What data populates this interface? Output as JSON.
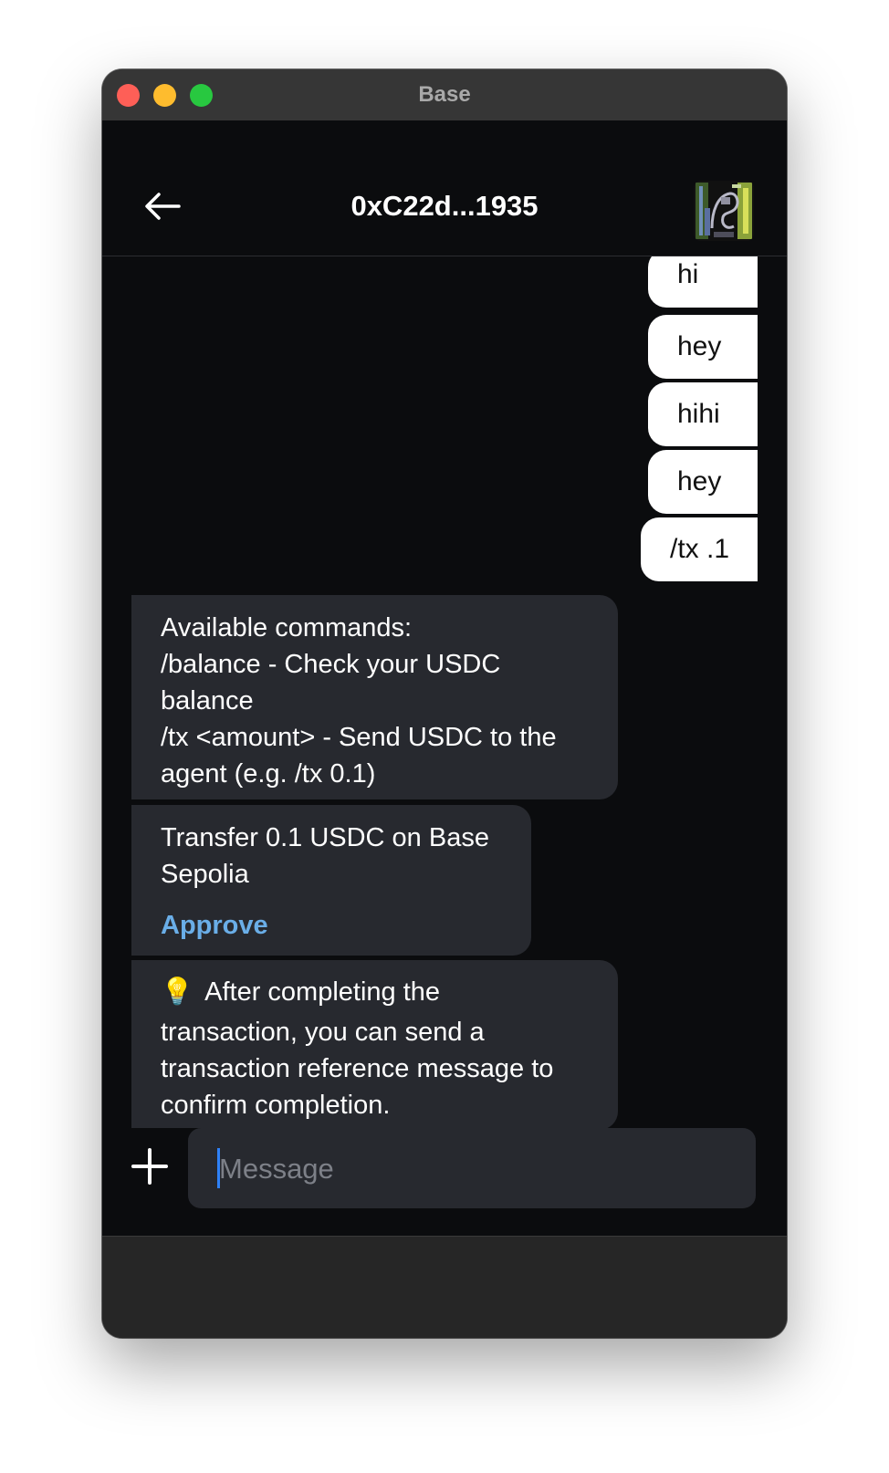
{
  "window": {
    "title": "Base"
  },
  "header": {
    "title": "0xC22d...1935",
    "back_icon": "arrow-left-icon",
    "avatar_icon": "pixel-avatar"
  },
  "messages": {
    "outgoing": [
      {
        "text": "hi"
      },
      {
        "text": "hey"
      },
      {
        "text": "hihi"
      },
      {
        "text": "hey"
      },
      {
        "text": "/tx .1"
      }
    ],
    "commands": {
      "lines": [
        "Available commands:",
        "/balance - Check your USDC",
        "balance",
        "/tx <amount> - Send USDC to the",
        "agent (e.g. /tx 0.1)"
      ]
    },
    "transfer": {
      "lines": [
        "Transfer 0.1 USDC on Base",
        "Sepolia"
      ],
      "approve_label": "Approve"
    },
    "tip": {
      "emoji": "💡",
      "lines": [
        "After completing the",
        "transaction, you can send a",
        "transaction reference message to",
        "confirm completion."
      ]
    }
  },
  "composer": {
    "placeholder": "Message",
    "add_icon": "plus-icon"
  },
  "colors": {
    "background": "#0b0c0e",
    "incoming_bubble": "#27292f",
    "outgoing_bubble": "#ffffff",
    "link": "#6aaee8"
  }
}
